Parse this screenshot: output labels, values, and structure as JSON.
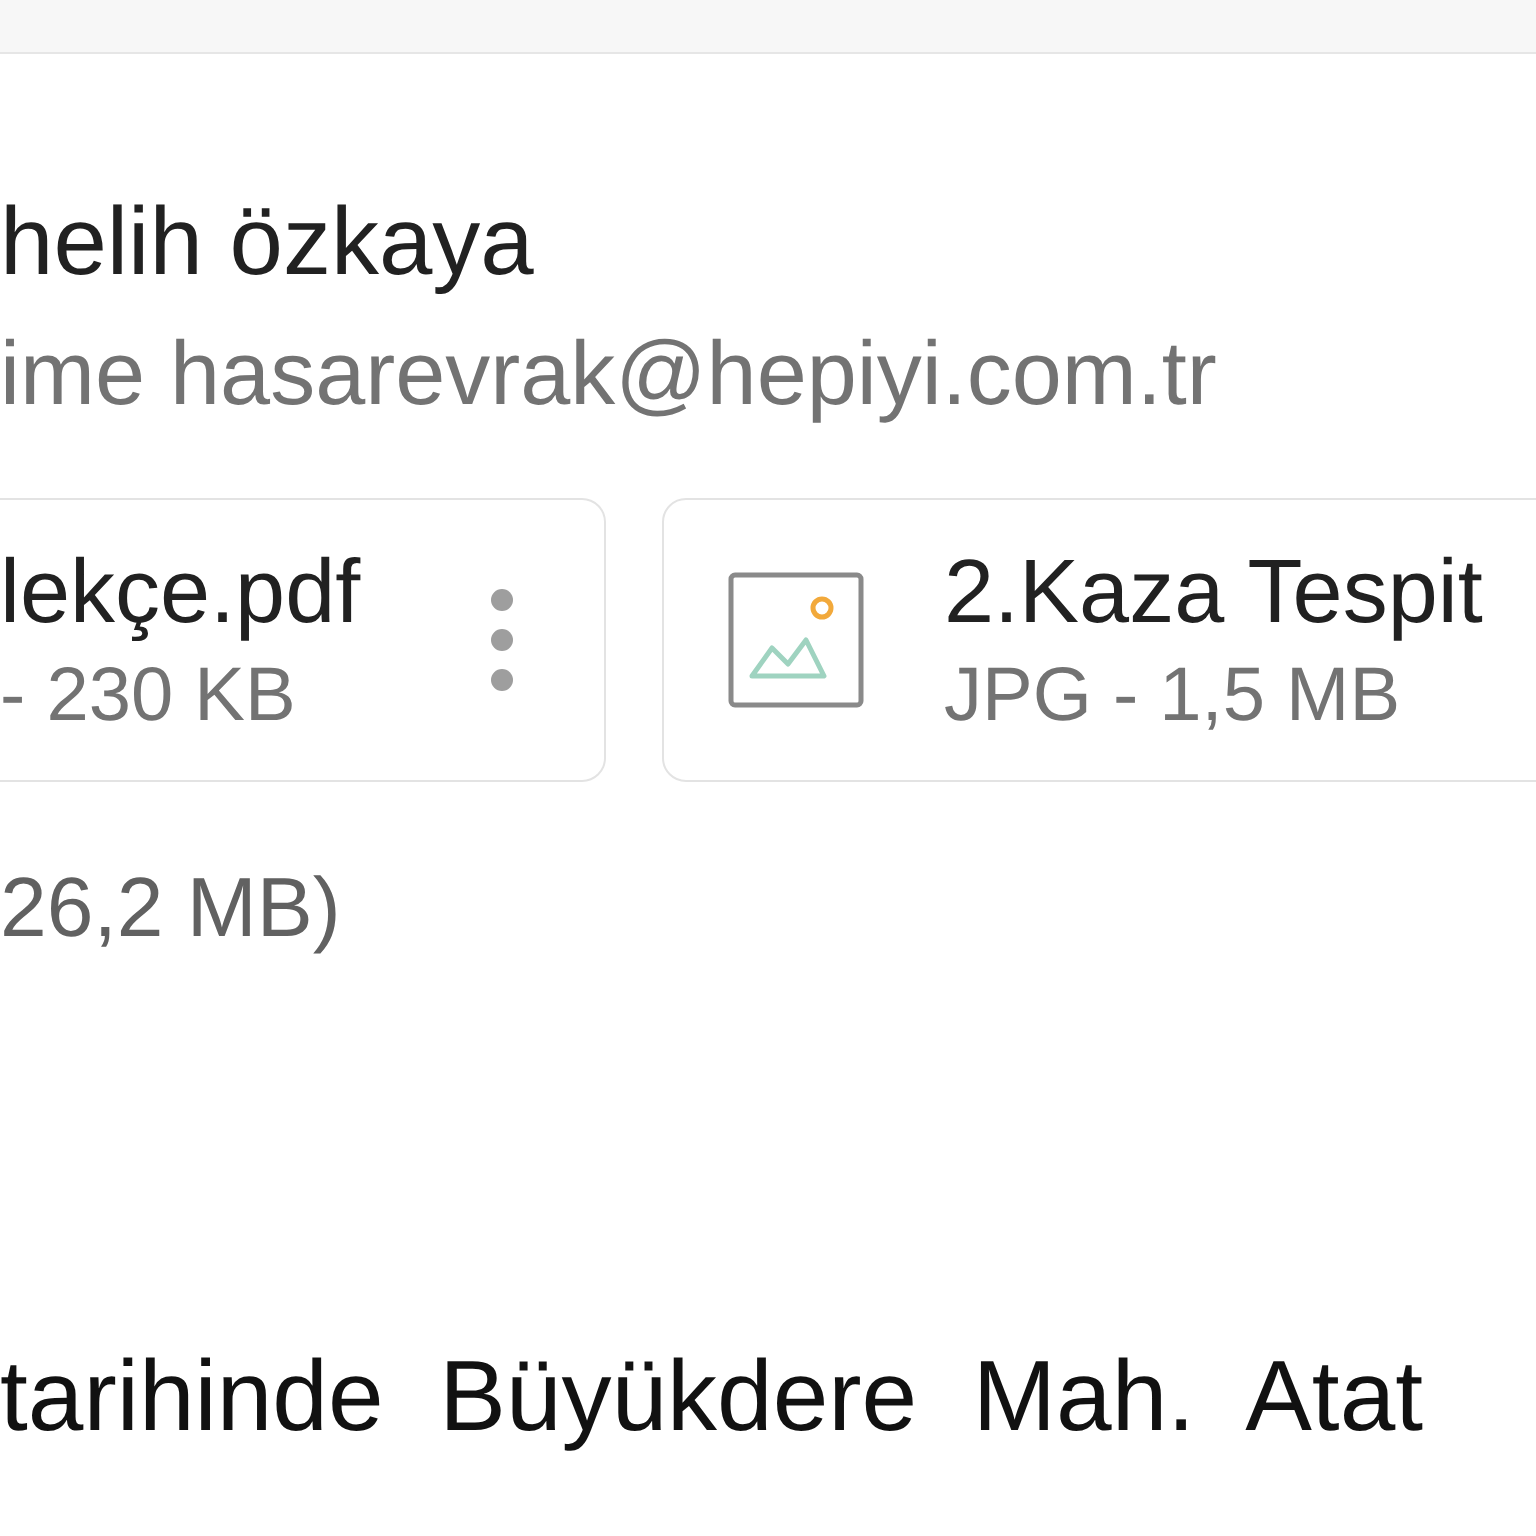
{
  "sender": {
    "name": "helih özkaya",
    "recipient_line": "ime hasarevrak@hepiyi.com.tr"
  },
  "attachments": [
    {
      "kind": "pdf",
      "name": "lekçe.pdf",
      "meta": "- 230 KB",
      "menu": true
    },
    {
      "kind": "image",
      "name": "2.Kaza Tespit",
      "meta": "JPG - 1,5 MB",
      "menu": false
    }
  ],
  "total_size": "26,2 MB)",
  "body_text": "tarihinde  Büyükdere  Mah.  Atat"
}
